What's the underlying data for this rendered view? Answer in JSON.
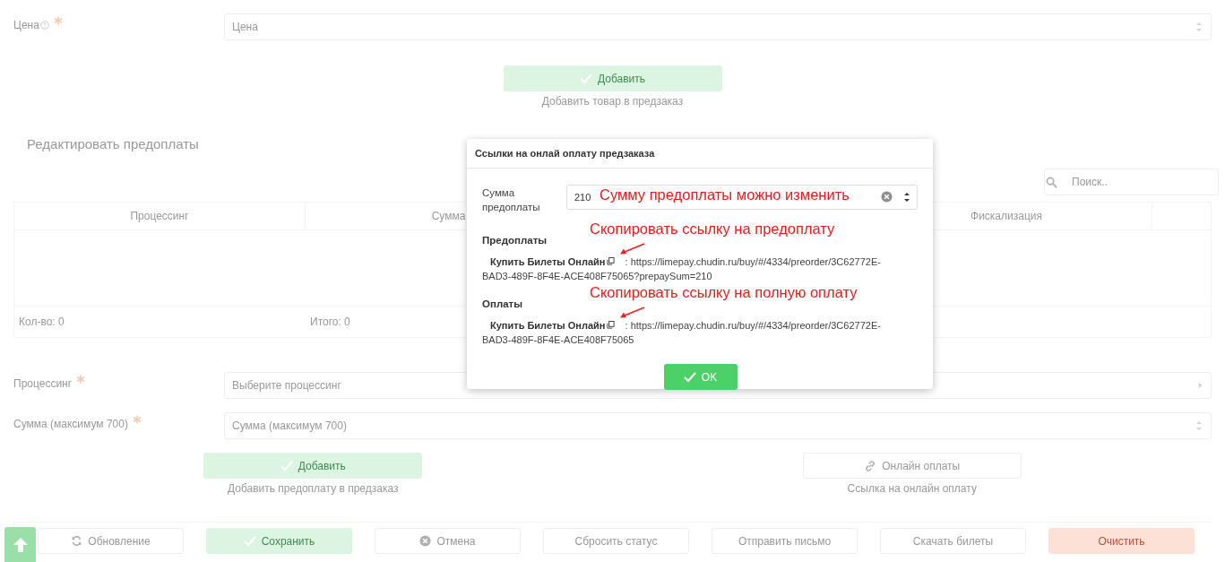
{
  "price_field": {
    "label": "Цена",
    "required": true,
    "placeholder": "Цена"
  },
  "add_product": {
    "button": "Добавить",
    "caption": "Добавить товар в предзаказ"
  },
  "prepayments": {
    "title": "Редактировать предоплаты",
    "search": {
      "placeholder": "Поиск.."
    },
    "table": {
      "columns": [
        "Процессинг",
        "Сумма",
        "Фискализация"
      ],
      "footer": [
        "Кол-во: 0",
        "Итого: 0"
      ]
    },
    "fields": [
      {
        "kind": "select",
        "label": "Процессинг",
        "required": true,
        "placeholder": "Выберите процессинг"
      },
      {
        "kind": "number",
        "label": "Сумма (максимум 700)",
        "required": true,
        "placeholder": "Сумма (максимум 700)"
      }
    ],
    "actions": [
      {
        "kind": "add",
        "label": "Добавить",
        "caption": "Добавить предоплату в предзаказ"
      },
      {
        "kind": "link",
        "label": "Онлайн оплаты",
        "caption": "Ссылка на онлайн оплату"
      }
    ]
  },
  "toolbar": [
    {
      "kind": "refresh",
      "label": "Обновление"
    },
    {
      "kind": "save",
      "label": "Сохранить"
    },
    {
      "kind": "cancel",
      "label": "Отмена"
    },
    {
      "kind": "plain",
      "label": "Сбросить статус"
    },
    {
      "kind": "plain",
      "label": "Отправить письмо"
    },
    {
      "kind": "plain",
      "label": "Скачать билеты"
    },
    {
      "kind": "danger",
      "label": "Очистить"
    }
  ],
  "dialog": {
    "title": "Ссылки на онлай оплату предзаказа",
    "amount": {
      "label": "Сумма предоплаты",
      "value": "210",
      "note": "Сумму предоплаты можно изменить"
    },
    "groups": [
      {
        "heading": "Предоплаты",
        "note": "Скопировать ссылку на предоплату",
        "link_title": "Купить Билеты Онлайн",
        "url": ": https://limepay.chudin.ru/buy/#/4334/preorder/3C62772E-BAD3-489F-8F4E-ACE408F75065?prepaySum=210"
      },
      {
        "heading": "Оплаты",
        "note": "Скопировать ссылку на полную оплату",
        "link_title": "Купить Билеты Онлайн",
        "url": ": https://limepay.chudin.ru/buy/#/4334/preorder/3C62772E-BAD3-489F-8F4E-ACE408F75065"
      }
    ],
    "ok": "OK"
  }
}
